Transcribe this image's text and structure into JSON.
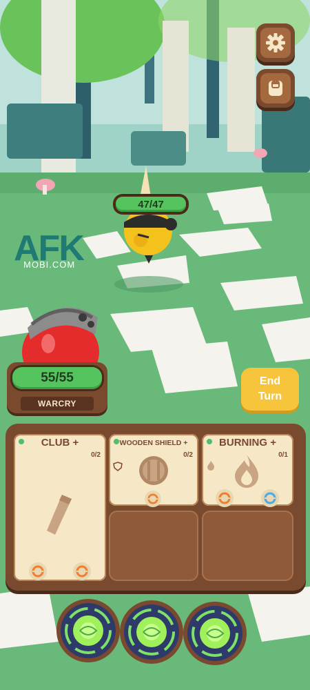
{
  "watermark": {
    "logo": "AFK",
    "site": "MOBI.COM"
  },
  "corner_buttons": {
    "settings_icon": "gear-icon",
    "bag_icon": "backpack-icon"
  },
  "enemy": {
    "hp_text": "47/47"
  },
  "player": {
    "hp_text": "55/55",
    "status": "WARCRY"
  },
  "end_turn": {
    "line1": "End",
    "line2": "Turn"
  },
  "cards": [
    {
      "title": "CLUB +",
      "count": "0/2",
      "icon": "club-icon"
    },
    {
      "title": "WOODEN SHIELD +",
      "count": "0/2",
      "icon": "shield-icon"
    },
    {
      "title": "BURNING +",
      "count": "0/1",
      "icon": "flame-icon"
    }
  ],
  "colors": {
    "accent_green": "#56c45e",
    "wood": "#7a4a2e",
    "parchment": "#f6e7c6",
    "end_turn": "#f7c53b",
    "orange_slot": "#ef7f2c",
    "blue_slot": "#4aa9e6"
  },
  "portals": [
    "energy-portal-1",
    "energy-portal-2",
    "energy-portal-3"
  ]
}
